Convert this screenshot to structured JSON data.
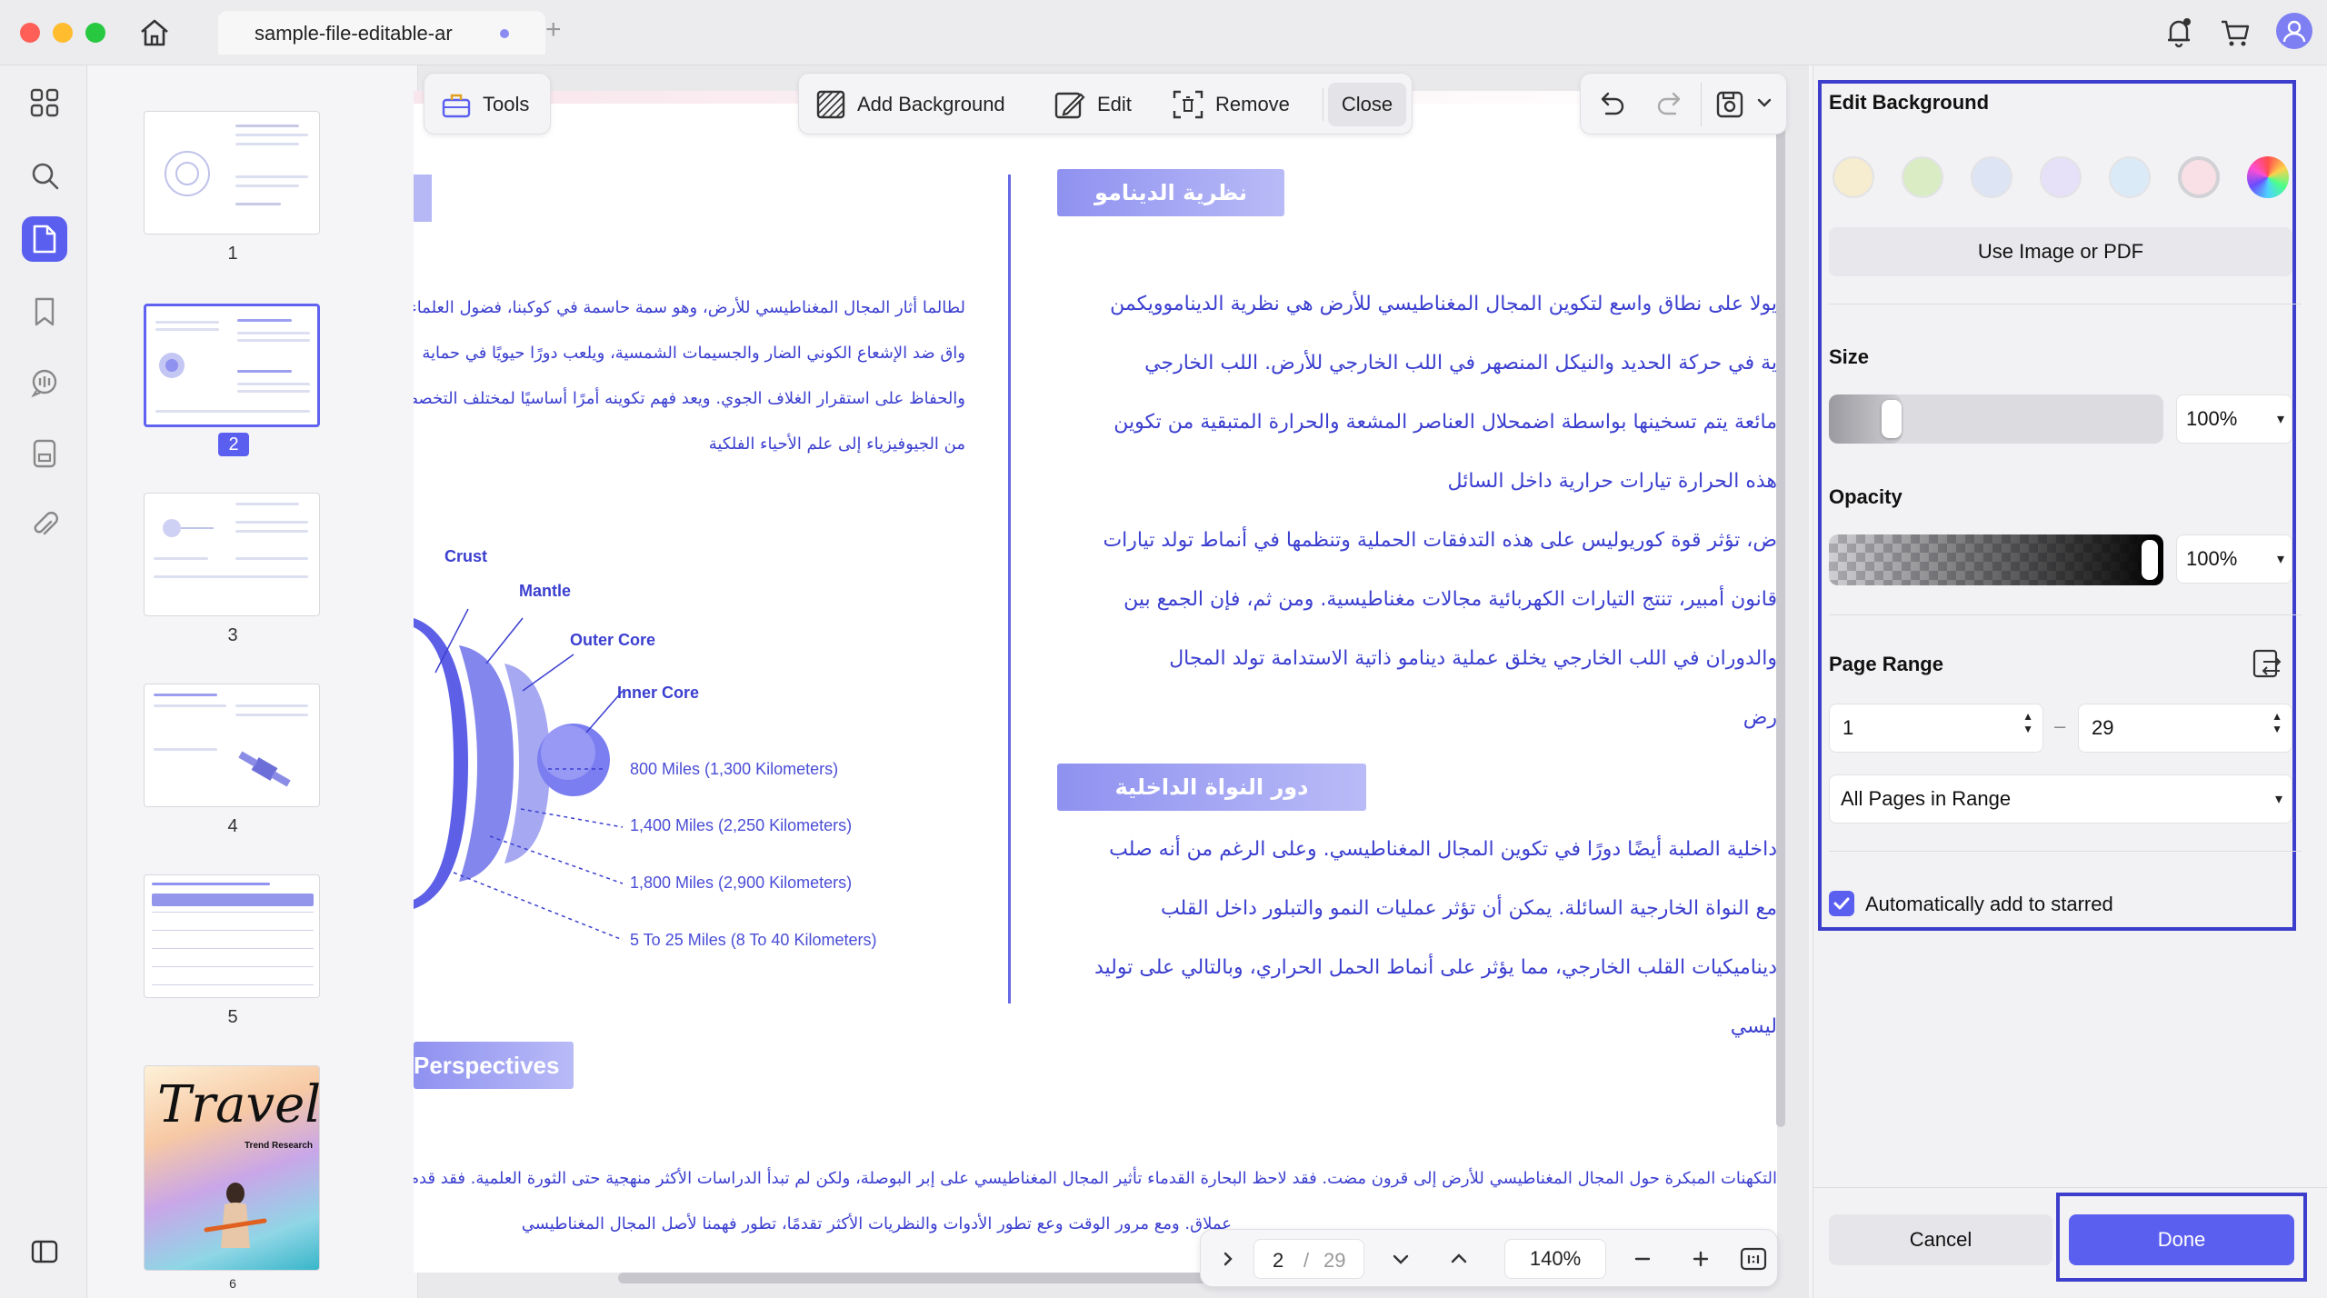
{
  "titlebar": {
    "tab_title": "sample-file-editable-ar",
    "new_tab_symbol": "+"
  },
  "thumbnails": [
    {
      "page": "1"
    },
    {
      "page": "2"
    },
    {
      "page": "3"
    },
    {
      "page": "4"
    },
    {
      "page": "5"
    },
    {
      "page": "6",
      "cover_title": "Travel",
      "cover_subtitle": "Trend Research"
    }
  ],
  "selected_page": "2",
  "toolbar": {
    "tools_label": "Tools",
    "add_background_label": "Add Background",
    "edit_label": "Edit",
    "remove_label": "Remove",
    "close_label": "Close"
  },
  "document": {
    "heading_dynamo": "نظرية الدينامو",
    "heading_inner_core": "دور النواة الداخلية",
    "heading_perspectives": "Perspectives",
    "right_col_lines": [
      "يولا على نطاق واسع لتكوين المجال المغناطيسي للأرض هي نظرية الديناموويكمن",
      "ية في حركة الحديد والنيكل المنصهر في اللب الخارجي للأرض. اللب الخارجي",
      "مائعة يتم تسخينها بواسطة اضمحلال العناصر المشعة والحرارة المتبقية من تكوين",
      "هذه الحرارة تيارات حرارية داخل السائل",
      "ض، تؤثر قوة كوريوليس على هذه التدفقات الحملية وتنظمها في أنماط تولد تيارات",
      "قانون أمبير، تنتج التيارات الكهربائية مجالات مغناطيسية. ومن ثم، فإن الجمع بين",
      "والدوران في اللب الخارجي يخلق عملية دينامو ذاتية الاستدامة تولد المجال",
      "رض"
    ],
    "right_col_lines_2": [
      "داخلية الصلبة أيضًا دورًا في تكوين المجال المغناطيسي. وعلى الرغم من أنه صلب",
      "مع النواة الخارجية السائلة. يمكن أن تؤثر عمليات النمو والتبلور داخل القلب",
      "ديناميكيات القلب الخارجي، مما يؤثر على أنماط الحمل الحراري، وبالتالي على توليد",
      "ليسي"
    ],
    "left_col_lines": [
      "لطالما أثار المجال المغناطيسي للأرض، وهو سمة حاسمة في كوكبنا، فضول العلماء",
      "واق ضد الإشعاع الكوني الضار والجسيمات الشمسية، ويلعب دورًا حيويًا في حماية",
      "والحفاظ على استقرار الغلاف الجوي. ويعد فهم تكوينه أمرًا أساسيًا لمختلف التخصصات",
      "من الجيوفيزياء إلى علم الأحياء الفلكية"
    ],
    "bottom_lines": [
      "التكهنات المبكرة حول المجال المغناطيسي للأرض إلى قرون مضت. فقد لاحظ البحارة القدماء تأثير المجال المغناطيسي على إبر البوصلة، ولكن لم تبدأ الدراسات الأكثر منهجية حتى الثورة العلمية. فقد قدم علماء",
      "عملاق. ومع مرور الوقت وعع تطور الأدوات والنظريات الأكثر تقدمًا، تطور فهمنا لأصل المجال المغناطيسي"
    ],
    "diagram_labels": {
      "crust": "Crust",
      "mantle": "Mantle",
      "outer_core": "Outer Core",
      "inner_core": "Inner Core",
      "d1": "800 Miles (1,300 Kilometers)",
      "d2": "1,400 Miles (2,250 Kilometers)",
      "d3": "1,800 Miles (2,900 Kilometers)",
      "d4": "5 To 25 Miles (8 To 40 Kilometers)"
    }
  },
  "panel": {
    "title": "Edit Background",
    "swatch_colors": [
      "#f6ecd0",
      "#d9ecc4",
      "#dde4f4",
      "#e6e0f8",
      "#dbeaf7",
      "#f8e0e6"
    ],
    "use_image_label": "Use Image or PDF",
    "size_label": "Size",
    "size_value": "100%",
    "size_level": 1.0,
    "opacity_label": "Opacity",
    "opacity_value": "100%",
    "opacity_level": 1.0,
    "page_range_label": "Page Range",
    "range_from": "1",
    "range_to": "29",
    "range_dash": "–",
    "range_mode": "All Pages in Range",
    "auto_star_label": "Automatically add to starred",
    "auto_star_checked": true,
    "cancel_label": "Cancel",
    "done_label": "Done",
    "accent": "#5b5ff0"
  },
  "bottomnav": {
    "current_page": "2",
    "separator": "/",
    "total_pages": "29",
    "zoom": "140%"
  }
}
